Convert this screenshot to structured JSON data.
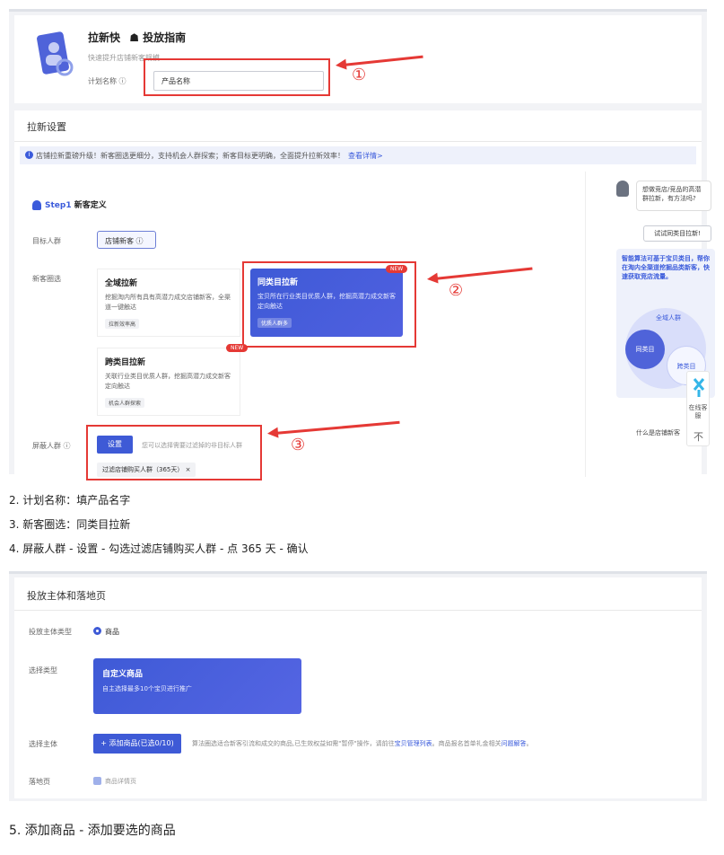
{
  "header": {
    "app_name": "拉新快",
    "guide_label": "投放指南",
    "subtitle": "快速提升店铺新客规模",
    "plan_name_label": "计划名称",
    "plan_name_placeholder": "产品名称"
  },
  "annotations": {
    "num1": "①",
    "num2": "②",
    "num3": "③"
  },
  "settings": {
    "section_title": "拉新设置",
    "notice_text": "店铺拉新重磅升级！新客圈选更细分，支持机会人群探索；新客目标更明确，全面提升拉新效率！",
    "notice_link": "查看详情>",
    "step_label": "Step1",
    "step_title": "新客定义",
    "target_label": "目标人群",
    "target_value": "店铺新客",
    "select_label": "新客圈选",
    "options": [
      {
        "title": "全域拉新",
        "desc": "挖掘淘内所有具有高潜力成交店铺新客，全渠道一键触达",
        "chip": "拉新效率高"
      },
      {
        "title": "同类目拉新",
        "desc": "宝贝所在行业类目优质人群，挖掘高潜力成交新客定向触达",
        "chip": "优质人群多",
        "badge": "NEW"
      },
      {
        "title": "跨类目拉新",
        "desc": "关联行业类目优质人群，挖掘高潜力成交新客定向触达",
        "chip": "机会人群探索",
        "badge": "NEW"
      }
    ],
    "block_label": "屏蔽人群",
    "set_button": "设置",
    "set_hint": "您可以选择需要过滤掉的非目标人群",
    "filter_tag": "过滤店铺购买人群（365天）"
  },
  "sidebar": {
    "bubble": "想做竞店/竞品的高潜群拉新，有方法吗?",
    "try_button": "试试同类目拉新!",
    "algo_text": "智能算法可基于宝贝类目，帮你在淘内全渠道挖掘品类新客，快速获取竞店流量。",
    "venn_all": "全域人群",
    "venn_same": "同类目",
    "venn_cross": "跨类目",
    "what_link": "什么是店铺新客",
    "service": "在线客服",
    "up_icon": "不"
  },
  "steps": [
    "2.  计划名称：填产品名字",
    "3.  新客圈选：同类目拉新",
    "4.  屏蔽人群 - 设置 - 勾选过滤店铺购买人群 - 点 365 天 - 确认"
  ],
  "landing": {
    "section_title": "投放主体和落地页",
    "subject_type_label": "投放主体类型",
    "subject_type_value": "商品",
    "select_type_label": "选择类型",
    "custom_title": "自定义商品",
    "custom_desc": "自主选择最多10个宝贝进行推广",
    "select_subject_label": "选择主体",
    "add_button": "+ 添加商品(已选0/10)",
    "add_hint_pre": "算法圈选适合新客引流和成交的商品,已生效权益如需\"暂停\"操作，请前往",
    "add_hint_link1": "宝贝管理列表",
    "add_hint_mid": "。商品报名首单礼金相关",
    "add_hint_link2": "问题解答",
    "add_hint_end": "。",
    "landing_label": "落地页",
    "landing_value": "商品详情页"
  },
  "step5": "5.  添加商品 - 添加要选的商品"
}
